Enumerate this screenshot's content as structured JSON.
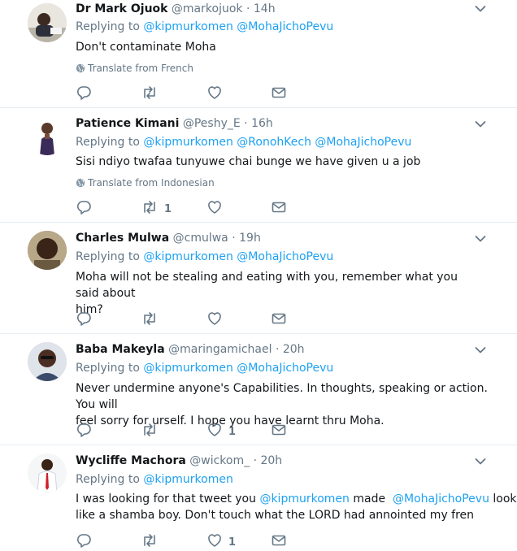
{
  "tweets": [
    {
      "name": "Dr Mark Ojuok",
      "handle": "@markojuok",
      "time": "14h",
      "reply_prefix": "Replying to",
      "reply_to": [
        "@kipmurkomen",
        "@MohaJichoPevu"
      ],
      "text": "Don't contaminate Moha",
      "translate": "Translate from French",
      "retweets": "",
      "likes": ""
    },
    {
      "name": "Patience Kimani",
      "handle": "@Peshy_E",
      "time": "16h",
      "reply_prefix": "Replying to",
      "reply_to": [
        "@kipmurkomen",
        "@RonohKech",
        "@MohaJichoPevu"
      ],
      "text": "Sisi ndiyo twafaa tunyuwe chai bunge we have given u a job",
      "translate": "Translate from Indonesian",
      "retweets": "1",
      "likes": ""
    },
    {
      "name": "Charles Mulwa",
      "handle": "@cmulwa",
      "time": "19h",
      "reply_prefix": "Replying to",
      "reply_to": [
        "@kipmurkomen",
        "@MohaJichoPevu"
      ],
      "text_line1": "Moha will not be stealing and eating with you, remember what you said about",
      "text_line2": "him?",
      "retweets": "",
      "likes": ""
    },
    {
      "name": "Baba Makeyla",
      "handle": "@maringamichael",
      "time": "20h",
      "reply_prefix": "Replying to",
      "reply_to": [
        "@kipmurkomen",
        "@MohaJichoPevu"
      ],
      "text_line1": "Never undermine anyone's Capabilities. In thoughts, speaking or action. You will",
      "text_line2": "feel sorry for urself. I hope you have learnt thru Moha.",
      "retweets": "",
      "likes": "1"
    },
    {
      "name": "Wycliffe Machora",
      "handle": "@wickom_",
      "time": "20h",
      "reply_prefix": "Replying to",
      "reply_to": [
        "@kipmurkomen"
      ],
      "text_a": "I was looking for that tweet you ",
      "text_link1": "@kipmurkomen",
      "text_b": " made  ",
      "text_link2": "@MohaJichoPevu",
      "text_c": " look",
      "text_line2": "like a shamba boy. Don't touch what the LORD had annointed my fren",
      "retweets": "",
      "likes": "1"
    }
  ],
  "separator": "·",
  "colors": {
    "link": "#1da1f2",
    "muted": "#657786",
    "border": "#e6ecf0"
  },
  "icons": {
    "reply": "reply-icon",
    "retweet": "retweet-icon",
    "like": "heart-icon",
    "dm": "envelope-icon",
    "caret": "chevron-down-icon",
    "globe": "globe-icon"
  }
}
